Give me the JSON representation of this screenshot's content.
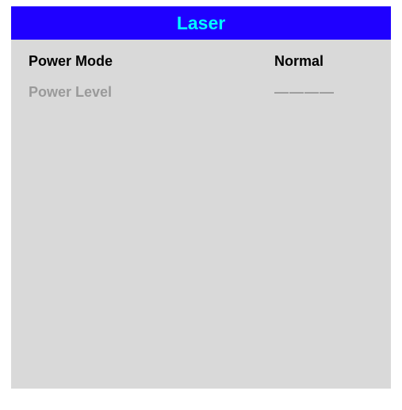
{
  "window": {
    "title": "Laser"
  },
  "menu": {
    "items": [
      {
        "label": "Power Mode",
        "value": "Normal",
        "enabled": true
      },
      {
        "label": "Power Level",
        "value": "————",
        "enabled": false
      }
    ]
  },
  "colors": {
    "title_bar_bg": "#1f00ff",
    "title_text": "#00ffff",
    "panel_bg": "#d9d9d9",
    "enabled_text": "#000000",
    "disabled_text": "#9a9a9a"
  }
}
